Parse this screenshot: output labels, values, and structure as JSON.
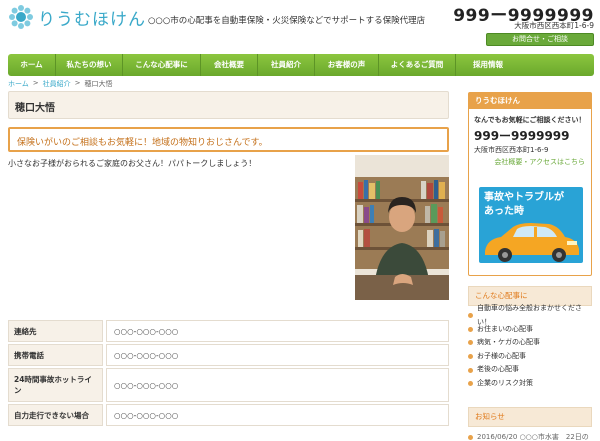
{
  "header": {
    "logo_text": "りうむほけん",
    "tagline": "○○○市の心配事を自動車保険・火災保険などでサポートする保険代理店",
    "phone": "999ー9999999",
    "address": "大阪市西区西本町1-6-9",
    "contact_button": "お問合せ・ご相談"
  },
  "nav": {
    "items": [
      "ホーム",
      "私たちの想い",
      "こんな心配事に",
      "会社概要",
      "社員紹介",
      "お客様の声",
      "よくあるご質問",
      "採用情報"
    ]
  },
  "breadcrumb": {
    "home": "ホーム",
    "section": "社員紹介",
    "current": "穂口大悟"
  },
  "main": {
    "title": "穂口大悟",
    "subtitle": "保険いがいのご相談もお気軽に！地域の物知りおじさんです。",
    "intro": "小さなお子様がおられるご家庭のお父さん！パパトークしましょう！",
    "info_rows": [
      {
        "label": "連絡先",
        "value": "○○○-○○○-○○○"
      },
      {
        "label": "携帯電話",
        "value": "○○○-○○○-○○○"
      },
      {
        "label": "24時間事故ホットライン",
        "value": "○○○-○○○-○○○"
      },
      {
        "label": "自力走行できない場合",
        "value": "○○○-○○○-○○○"
      }
    ]
  },
  "sidebar": {
    "card_title": "りうむほけん",
    "lead": "なんでもお気軽にご相談ください！",
    "phone": "999ー9999999",
    "address": "大阪市西区西本町1-6-9",
    "link": "会社概要・アクセスはこちら",
    "banner_text": [
      "事故やトラブルが",
      "あった時"
    ],
    "concerns_title": "こんな心配事に",
    "concerns": [
      "自動車の悩み全般おまかせください！",
      "お住まいの心配事",
      "病気・ケガの心配事",
      "お子様の心配事",
      "老後の心配事",
      "企業のリスク対策"
    ],
    "news_title": "お知らせ",
    "news_item": "2016/06/20 ○○○市水害　22日の"
  },
  "colors": {
    "brand_blue": "#3aa9c9",
    "nav_green": "#7ab835",
    "accent_orange": "#e8a24a",
    "beige": "#f7f1e8"
  }
}
